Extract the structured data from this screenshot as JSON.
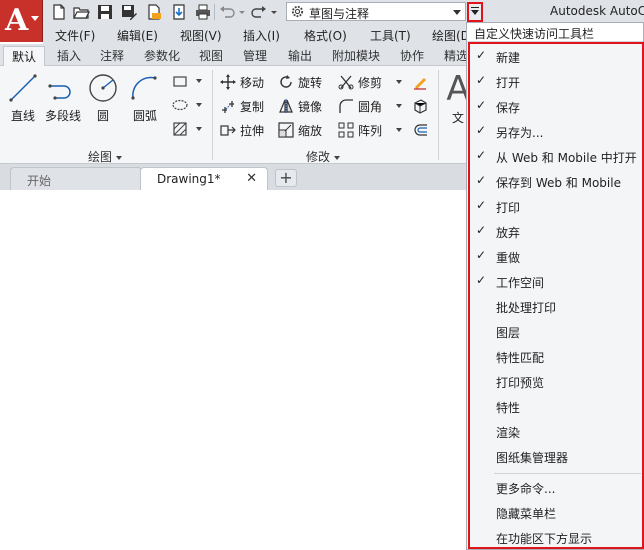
{
  "app": {
    "title": "Autodesk AutoC",
    "logo_letter": "A"
  },
  "quick_access": {
    "workspace": "草图与注释"
  },
  "menubar": {
    "items": [
      "文件(F)",
      "编辑(E)",
      "视图(V)",
      "插入(I)",
      "格式(O)",
      "工具(T)",
      "绘图(D)"
    ]
  },
  "ribbon": {
    "tabs": [
      "默认",
      "插入",
      "注释",
      "参数化",
      "视图",
      "管理",
      "输出",
      "附加模块",
      "协作",
      "精选"
    ],
    "active_tab": "默认",
    "draw_panel": {
      "title": "绘图",
      "line": "直线",
      "polyline": "多段线",
      "circle": "圆",
      "arc": "圆弧"
    },
    "modify_panel": {
      "title": "修改",
      "move": "移动",
      "rotate": "旋转",
      "trim": "修剪",
      "copy": "复制",
      "mirror": "镜像",
      "fillet": "圆角",
      "stretch": "拉伸",
      "scale": "缩放",
      "array": "阵列"
    },
    "text_panel": {
      "text_label": "文",
      "glyph": "A"
    }
  },
  "doc_tabs": {
    "start": "开始",
    "drawing": "Drawing1*",
    "close": "✕",
    "add": "+"
  },
  "qat_menu": {
    "title": "自定义快速访问工具栏",
    "checked_items": [
      "新建",
      "打开",
      "保存",
      "另存为...",
      "从 Web 和 Mobile 中打开",
      "保存到 Web 和 Mobile",
      "打印",
      "放弃",
      "重做",
      "工作空间"
    ],
    "unchecked_items": [
      "批处理打印",
      "图层",
      "特性匹配",
      "打印预览",
      "特性",
      "渲染",
      "图纸集管理器"
    ],
    "extra_items": [
      "更多命令...",
      "隐藏菜单栏",
      "在功能区下方显示"
    ],
    "check_glyph": "✓"
  },
  "colors": {
    "accent_red": "#e0141b",
    "app_button": "#c8312a",
    "chrome": "#dfe3e8"
  }
}
